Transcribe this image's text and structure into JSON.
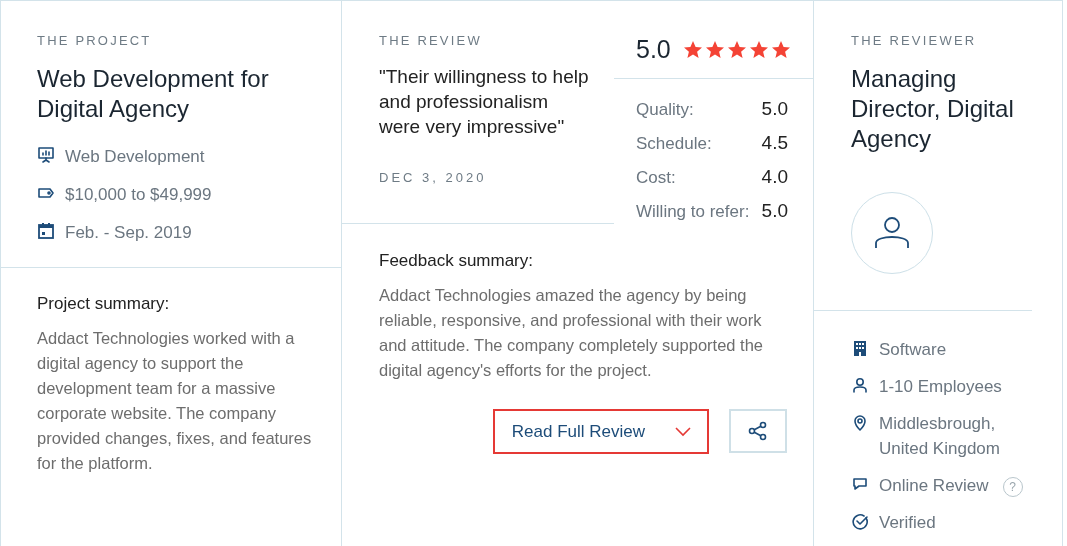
{
  "project": {
    "label": "THE PROJECT",
    "title": "Web Development for Digital Agency",
    "details": [
      {
        "kind": "service",
        "text": "Web Development"
      },
      {
        "kind": "budget",
        "text": "$10,000 to $49,999"
      },
      {
        "kind": "dates",
        "text": "Feb. - Sep. 2019"
      }
    ],
    "summary_heading": "Project summary:",
    "summary": "Addact Technologies worked with a digital agency to support the development team for a massive corporate website. The company provided changes, fixes, and features for the platform."
  },
  "review": {
    "label": "THE REVIEW",
    "quote": "\"Their willingness to help and professionalism were very impressive\"",
    "date": "DEC 3, 2020",
    "overall": "5.0",
    "stars": 5,
    "ratings": [
      {
        "label": "Quality:",
        "value": "5.0"
      },
      {
        "label": "Schedule:",
        "value": "4.5"
      },
      {
        "label": "Cost:",
        "value": "4.0"
      },
      {
        "label": "Willing to refer:",
        "value": "5.0"
      }
    ],
    "feedback_heading": "Feedback summary:",
    "feedback": "Addact Technologies amazed the agency by being reliable, responsive, and professional with their work and attitude. The company completely supported the digital agency's efforts for the project.",
    "read_button": "Read Full Review"
  },
  "reviewer": {
    "label": "THE REVIEWER",
    "title": "Managing Director, Digital Agency",
    "details": [
      {
        "kind": "industry",
        "text": "Software"
      },
      {
        "kind": "size",
        "text": "1-10 Employees"
      },
      {
        "kind": "location",
        "text": "Middlesbrough, United Kingdom"
      },
      {
        "kind": "source",
        "text": "Online Review",
        "help": "?"
      },
      {
        "kind": "verification",
        "text": "Verified"
      }
    ]
  }
}
